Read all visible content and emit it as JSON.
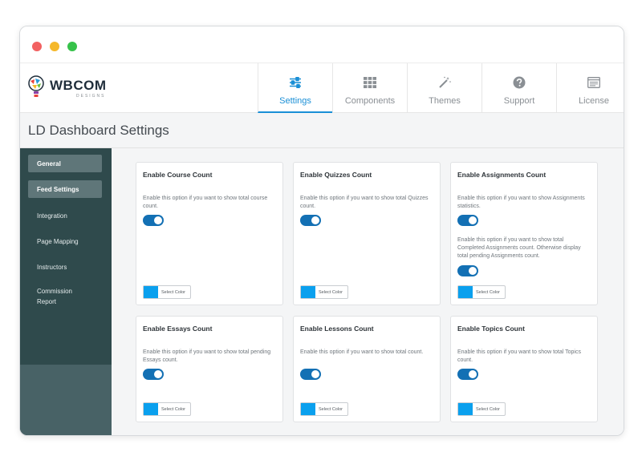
{
  "brand": {
    "name": "WBCOM",
    "sub": "DESIGNS"
  },
  "tabs": [
    {
      "label": "Settings",
      "icon": "sliders-icon",
      "active": true
    },
    {
      "label": "Components",
      "icon": "grid-icon",
      "active": false
    },
    {
      "label": "Themes",
      "icon": "magic-wand-icon",
      "active": false
    },
    {
      "label": "Support",
      "icon": "question-circle-icon",
      "active": false
    },
    {
      "label": "License",
      "icon": "license-card-icon",
      "active": false
    }
  ],
  "page": {
    "title": "LD Dashboard Settings"
  },
  "sidebar": {
    "items": [
      {
        "label": "General"
      },
      {
        "label": "Feed Settings"
      },
      {
        "label": "Integration"
      },
      {
        "label": "Page Mapping"
      },
      {
        "label": "Instructors"
      },
      {
        "label": "Commission Report"
      }
    ]
  },
  "colors": {
    "accent": "#1a8fd6",
    "toggle": "#1370b4",
    "swatch": "#0aa0ee",
    "sidebar": "#2f4a4c"
  },
  "cards": [
    {
      "title": "Enable Course Count",
      "desc": "Enable this option if you want to show total course count.",
      "toggle_on": true,
      "color_label": "Select Color"
    },
    {
      "title": "Enable Quizzes Count",
      "desc": "Enable this option if you want to show total Quizzes count.",
      "toggle_on": true,
      "color_label": "Select Color"
    },
    {
      "title": "Enable Assignments Count",
      "desc": "Enable this option if you want to show Assignments statistics.",
      "desc2": "Enable this option if you want to show total Completed Assignments count. Otherwise display total pending Assignments count.",
      "toggle_on": true,
      "toggle2_on": true,
      "color_label": "Select Color"
    },
    {
      "title": "Enable Essays Count",
      "desc": "Enable this option if you want to show total pending Essays count.",
      "toggle_on": true,
      "color_label": "Select Color"
    },
    {
      "title": "Enable Lessons Count",
      "desc": "Enable this option if you want to show total count.",
      "toggle_on": true,
      "color_label": "Select Color"
    },
    {
      "title": "Enable Topics Count",
      "desc": "Enable this option if you want to show total Topics count.",
      "toggle_on": true,
      "color_label": "Select Color"
    }
  ]
}
